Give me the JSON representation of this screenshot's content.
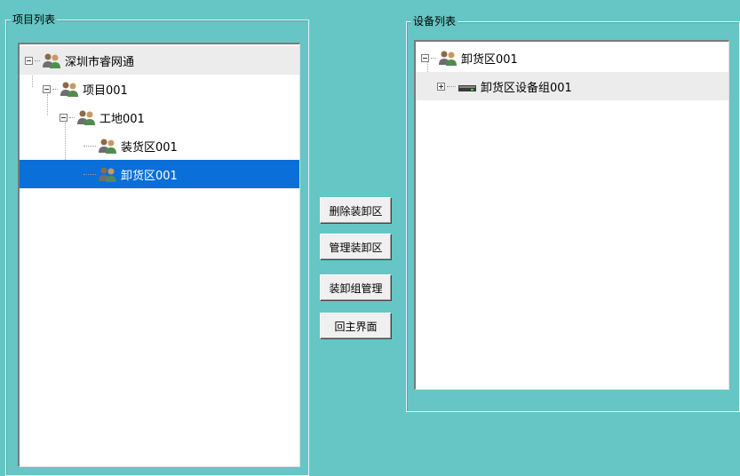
{
  "project_panel": {
    "title": "项目列表",
    "nodes": [
      {
        "label": "深圳市睿网通"
      },
      {
        "label": "项目001"
      },
      {
        "label": "工地001"
      },
      {
        "label": "装货区001"
      },
      {
        "label": "卸货区001"
      }
    ]
  },
  "buttons": {
    "delete_label": "删除装卸区",
    "manage_area_label": "管理装卸区",
    "manage_group_label": "装卸组管理",
    "home_label": "回主界面"
  },
  "device_panel": {
    "title": "设备列表",
    "nodes": [
      {
        "label": "卸货区001"
      },
      {
        "label": "卸货区设备组001"
      }
    ]
  },
  "colors": {
    "background": "#66c5c5",
    "selection": "#0a6fd8"
  }
}
